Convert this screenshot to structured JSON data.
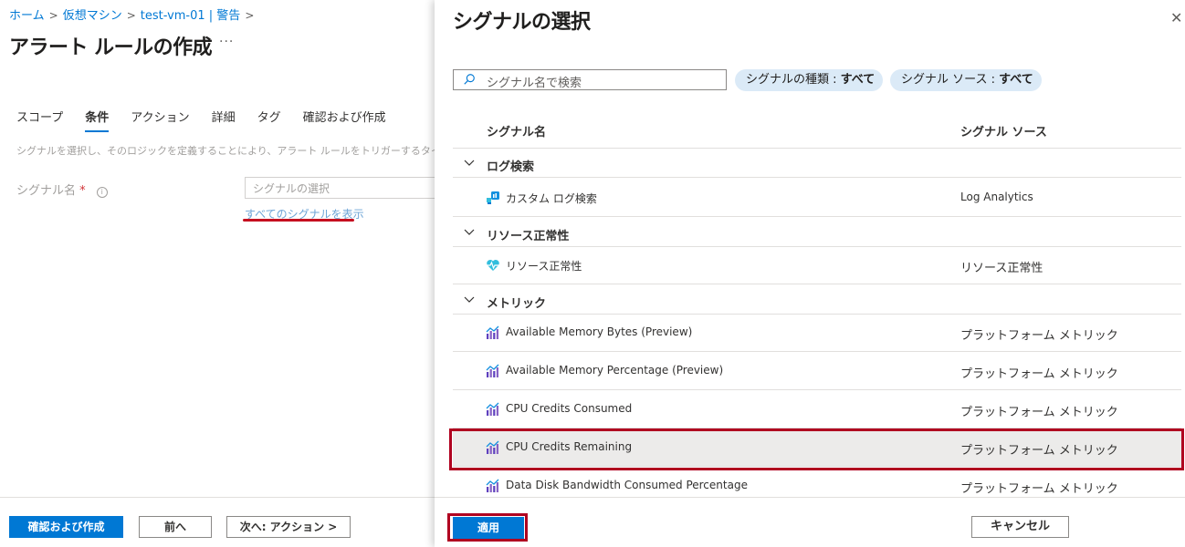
{
  "breadcrumb": {
    "items": [
      "ホーム",
      "仮想マシン",
      "test-vm-01 | 警告"
    ]
  },
  "page": {
    "title": "アラート ルールの作成",
    "more": "···"
  },
  "tabs": [
    "スコープ",
    "条件",
    "アクション",
    "詳細",
    "タグ",
    "確認および作成"
  ],
  "condition": {
    "description": "シグナルを選択し、そのロジックを定義することにより、アラート ルールをトリガーするタイミングを",
    "signal_label": "シグナル名",
    "required_mark": "*",
    "signal_placeholder": "シグナルの選択",
    "show_all_link": "すべてのシグナルを表示"
  },
  "left_footer": {
    "review_create": "確認および作成",
    "previous": "前へ",
    "next": "次へ: アクション >"
  },
  "panel": {
    "title": "シグナルの選択",
    "search_placeholder": "シグナル名で検索",
    "filter_type_label": "シグナルの種類 : ",
    "filter_type_value": "すべて",
    "filter_source_label": "シグナル ソース : ",
    "filter_source_value": "すべて",
    "col_name": "シグナル名",
    "col_source": "シグナル ソース",
    "groups": [
      {
        "label": "ログ検索",
        "items": [
          {
            "name": "カスタム ログ検索",
            "source": "Log Analytics"
          }
        ]
      },
      {
        "label": "リソース正常性",
        "items": [
          {
            "name": "リソース正常性",
            "source": "リソース正常性"
          }
        ]
      },
      {
        "label": "メトリック",
        "items": [
          {
            "name": "Available Memory Bytes (Preview)",
            "source": "プラットフォーム メトリック"
          },
          {
            "name": "Available Memory Percentage (Preview)",
            "source": "プラットフォーム メトリック"
          },
          {
            "name": "CPU Credits Consumed",
            "source": "プラットフォーム メトリック"
          },
          {
            "name": "CPU Credits Remaining",
            "source": "プラットフォーム メトリック"
          },
          {
            "name": "Data Disk Bandwidth Consumed Percentage",
            "source": "プラットフォーム メトリック"
          }
        ]
      }
    ],
    "apply": "適用",
    "cancel": "キャンセル"
  },
  "colors": {
    "accent": "#0078d4",
    "highlight_outline": "#b00020",
    "selected_row": "#ecebea"
  }
}
